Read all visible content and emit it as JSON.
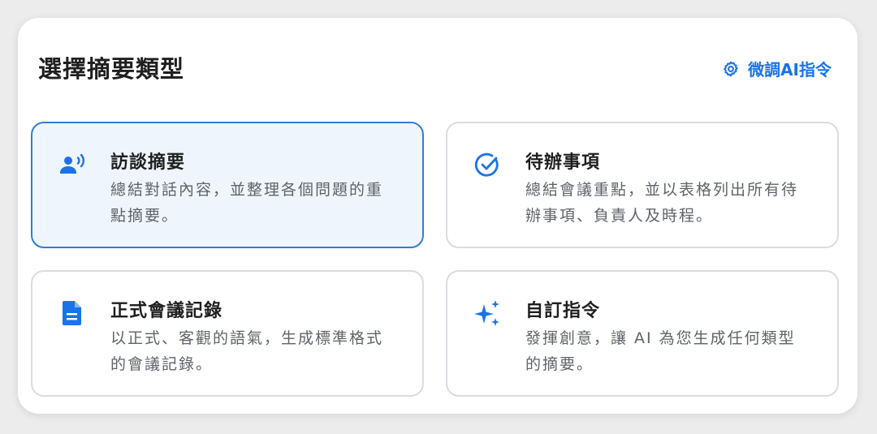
{
  "header": {
    "title": "選擇摘要類型",
    "tune_label": "微調AI指令",
    "tune_icon": "gear-icon"
  },
  "colors": {
    "accent": "#1a73e8",
    "selected_bg": "#eef5fc",
    "selected_border": "#2f7fd1"
  },
  "cards": [
    {
      "title": "訪談摘要",
      "description": "總結對話內容，並整理各個問題的重點摘要。",
      "icon": "person-voice-icon",
      "selected": true
    },
    {
      "title": "待辦事項",
      "description": "總結會議重點，並以表格列出所有待辦事項、負責人及時程。",
      "icon": "check-circle-icon",
      "selected": false
    },
    {
      "title": "正式會議記錄",
      "description": "以正式、客觀的語氣，生成標準格式的會議記錄。",
      "icon": "document-icon",
      "selected": false
    },
    {
      "title": "自訂指令",
      "description": "發揮創意，讓 AI 為您生成任何類型的摘要。",
      "icon": "sparkle-icon",
      "selected": false
    }
  ]
}
